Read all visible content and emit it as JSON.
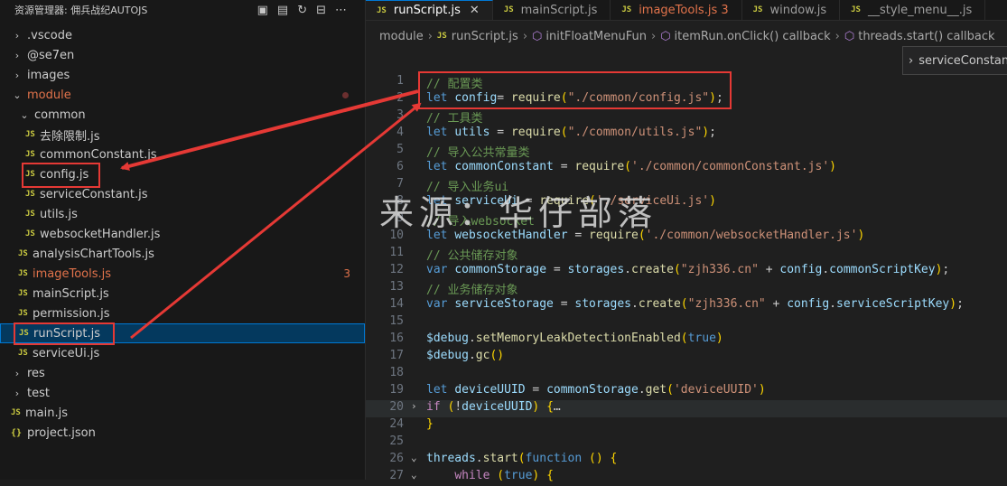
{
  "explorer": {
    "title": "资源管理器: 佣兵战纪AUTOJS",
    "actions": [
      "new-file-icon",
      "new-folder-icon",
      "refresh-icon",
      "collapse-all-icon",
      "more-icon"
    ],
    "items": [
      {
        "label": ".vscode",
        "type": "folder",
        "expanded": false,
        "depth": 0
      },
      {
        "label": "@se7en",
        "type": "folder",
        "expanded": false,
        "depth": 0
      },
      {
        "label": "images",
        "type": "folder",
        "expanded": false,
        "depth": 0
      },
      {
        "label": "module",
        "type": "folder",
        "expanded": true,
        "depth": 0,
        "status": "modified"
      },
      {
        "label": "common",
        "type": "folder",
        "expanded": true,
        "depth": 1
      },
      {
        "label": "去除限制.js",
        "type": "js",
        "depth": 2
      },
      {
        "label": "commonConstant.js",
        "type": "js",
        "depth": 2
      },
      {
        "label": "config.js",
        "type": "js",
        "depth": 2
      },
      {
        "label": "serviceConstant.js",
        "type": "js",
        "depth": 2
      },
      {
        "label": "utils.js",
        "type": "js",
        "depth": 2
      },
      {
        "label": "websocketHandler.js",
        "type": "js",
        "depth": 2
      },
      {
        "label": "analysisChartTools.js",
        "type": "js",
        "depth": 1
      },
      {
        "label": "imageTools.js",
        "type": "js",
        "depth": 1,
        "status": "modified",
        "badge": "3"
      },
      {
        "label": "mainScript.js",
        "type": "js",
        "depth": 1
      },
      {
        "label": "permission.js",
        "type": "js",
        "depth": 1
      },
      {
        "label": "runScript.js",
        "type": "js",
        "depth": 1,
        "selected": true
      },
      {
        "label": "serviceUi.js",
        "type": "js",
        "depth": 1
      },
      {
        "label": "res",
        "type": "folder",
        "expanded": false,
        "depth": 0
      },
      {
        "label": "test",
        "type": "folder",
        "expanded": false,
        "depth": 0
      },
      {
        "label": "main.js",
        "type": "js",
        "depth": 0
      },
      {
        "label": "project.json",
        "type": "json",
        "depth": 0
      }
    ]
  },
  "tabs": [
    {
      "label": "runScript.js",
      "active": true,
      "close": "✕"
    },
    {
      "label": "mainScript.js"
    },
    {
      "label": "imageTools.js 3",
      "modified": true
    },
    {
      "label": "window.js"
    },
    {
      "label": "__style_menu__.js"
    }
  ],
  "breadcrumb": {
    "folder": "module",
    "file": "runScript.js",
    "symbols": [
      "initFloatMenuFun",
      "itemRun.onClick() callback",
      "threads.start() callback"
    ]
  },
  "peek": {
    "label": "serviceConstant"
  },
  "icons": {
    "js": "JS",
    "json": "{}"
  },
  "code": [
    {
      "n": "1",
      "toks": [
        [
          "c-com",
          "// 配置类"
        ]
      ]
    },
    {
      "n": "2",
      "toks": [
        [
          "c-kw",
          "let "
        ],
        [
          "c-var",
          "config"
        ],
        [
          "",
          "="
        ],
        [
          "c-fn",
          " require"
        ],
        [
          "c-p",
          "("
        ],
        [
          "c-str",
          "\"./common/config.js\""
        ],
        [
          "c-p",
          ")"
        ],
        [
          "",
          ";"
        ]
      ]
    },
    {
      "n": "3",
      "toks": [
        [
          "c-com",
          "// 工具类"
        ]
      ]
    },
    {
      "n": "4",
      "toks": [
        [
          "c-kw",
          "let "
        ],
        [
          "c-var",
          "utils"
        ],
        [
          "",
          " = "
        ],
        [
          "c-fn",
          "require"
        ],
        [
          "c-p",
          "("
        ],
        [
          "c-str",
          "\"./common/utils.js\""
        ],
        [
          "c-p",
          ")"
        ],
        [
          "",
          ";"
        ]
      ]
    },
    {
      "n": "5",
      "toks": [
        [
          "c-com",
          "// 导入公共常量类"
        ]
      ]
    },
    {
      "n": "6",
      "toks": [
        [
          "c-kw",
          "let "
        ],
        [
          "c-var",
          "commonConstant"
        ],
        [
          "",
          " = "
        ],
        [
          "c-fn",
          "require"
        ],
        [
          "c-p",
          "("
        ],
        [
          "c-str",
          "'./common/commonConstant.js'"
        ],
        [
          "c-p",
          ")"
        ]
      ]
    },
    {
      "n": "7",
      "toks": [
        [
          "c-com",
          "// 导入业务ui"
        ]
      ]
    },
    {
      "n": "8",
      "toks": [
        [
          "c-kw",
          "let "
        ],
        [
          "c-var",
          "serviceUi"
        ],
        [
          "",
          " = "
        ],
        [
          "c-fn",
          "require"
        ],
        [
          "c-p",
          "("
        ],
        [
          "c-str",
          "'./serviceUi.js'"
        ],
        [
          "c-p",
          ")"
        ]
      ]
    },
    {
      "n": "9",
      "toks": [
        [
          "c-com",
          "// 导入websocket"
        ]
      ]
    },
    {
      "n": "10",
      "toks": [
        [
          "c-kw",
          "let "
        ],
        [
          "c-var",
          "websocketHandler"
        ],
        [
          "",
          " = "
        ],
        [
          "c-fn",
          "require"
        ],
        [
          "c-p",
          "("
        ],
        [
          "c-str",
          "'./common/websocketHandler.js'"
        ],
        [
          "c-p",
          ")"
        ]
      ]
    },
    {
      "n": "11",
      "toks": [
        [
          "c-com",
          "// 公共储存对象"
        ]
      ]
    },
    {
      "n": "12",
      "toks": [
        [
          "c-kw",
          "var "
        ],
        [
          "c-var",
          "commonStorage"
        ],
        [
          "",
          " = "
        ],
        [
          "c-var",
          "storages"
        ],
        [
          "",
          "."
        ],
        [
          "c-fn",
          "create"
        ],
        [
          "c-p",
          "("
        ],
        [
          "c-str",
          "\"zjh336.cn\""
        ],
        [
          "",
          " + "
        ],
        [
          "c-var",
          "config"
        ],
        [
          "",
          "."
        ],
        [
          "c-var",
          "commonScriptKey"
        ],
        [
          "c-p",
          ")"
        ],
        [
          "",
          ";"
        ]
      ]
    },
    {
      "n": "13",
      "toks": [
        [
          "c-com",
          "// 业务储存对象"
        ]
      ]
    },
    {
      "n": "14",
      "toks": [
        [
          "c-kw",
          "var "
        ],
        [
          "c-var",
          "serviceStorage"
        ],
        [
          "",
          " = "
        ],
        [
          "c-var",
          "storages"
        ],
        [
          "",
          "."
        ],
        [
          "c-fn",
          "create"
        ],
        [
          "c-p",
          "("
        ],
        [
          "c-str",
          "\"zjh336.cn\""
        ],
        [
          "",
          " + "
        ],
        [
          "c-var",
          "config"
        ],
        [
          "",
          "."
        ],
        [
          "c-var",
          "serviceScriptKey"
        ],
        [
          "c-p",
          ")"
        ],
        [
          "",
          ";"
        ]
      ]
    },
    {
      "n": "15",
      "toks": []
    },
    {
      "n": "16",
      "toks": [
        [
          "c-var",
          "$debug"
        ],
        [
          "",
          "."
        ],
        [
          "c-fn",
          "setMemoryLeakDetectionEnabled"
        ],
        [
          "c-p",
          "("
        ],
        [
          "c-kw",
          "true"
        ],
        [
          "c-p",
          ")"
        ]
      ]
    },
    {
      "n": "17",
      "toks": [
        [
          "c-var",
          "$debug"
        ],
        [
          "",
          "."
        ],
        [
          "c-fn",
          "gc"
        ],
        [
          "c-p",
          "()"
        ]
      ]
    },
    {
      "n": "18",
      "toks": []
    },
    {
      "n": "19",
      "toks": [
        [
          "c-kw",
          "let "
        ],
        [
          "c-var",
          "deviceUUID"
        ],
        [
          "",
          " = "
        ],
        [
          "c-var",
          "commonStorage"
        ],
        [
          "",
          "."
        ],
        [
          "c-fn",
          "get"
        ],
        [
          "c-p",
          "("
        ],
        [
          "c-str",
          "'deviceUUID'"
        ],
        [
          "c-p",
          ")"
        ]
      ]
    },
    {
      "n": "20",
      "fold": "›",
      "hl": true,
      "toks": [
        [
          "c-ctl",
          "if "
        ],
        [
          "c-p",
          "("
        ],
        [
          "",
          "!"
        ],
        [
          "c-var",
          "deviceUUID"
        ],
        [
          "c-p",
          ")"
        ],
        [
          "",
          " "
        ],
        [
          "c-p",
          "{"
        ],
        [
          "",
          "…"
        ]
      ]
    },
    {
      "n": "24",
      "toks": [
        [
          "c-p",
          "}"
        ]
      ]
    },
    {
      "n": "25",
      "toks": []
    },
    {
      "n": "26",
      "fold": "⌄",
      "toks": [
        [
          "c-var",
          "threads"
        ],
        [
          "",
          "."
        ],
        [
          "c-fn",
          "start"
        ],
        [
          "c-p",
          "("
        ],
        [
          "c-kw",
          "function "
        ],
        [
          "c-p",
          "() {"
        ]
      ]
    },
    {
      "n": "27",
      "fold": "⌄",
      "toks": [
        [
          "",
          "    "
        ],
        [
          "c-ctl",
          "while "
        ],
        [
          "c-p",
          "("
        ],
        [
          "c-kw",
          "true"
        ],
        [
          "c-p",
          ") {"
        ]
      ]
    }
  ],
  "watermark": "来源：华仔部落",
  "annotation_color": "#e53935"
}
